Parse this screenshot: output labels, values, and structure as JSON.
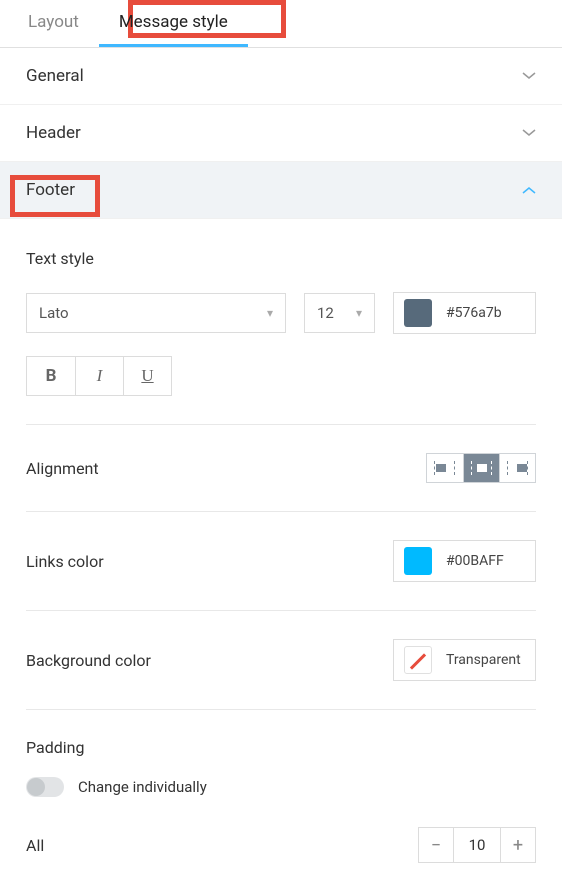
{
  "tabs": {
    "layout": "Layout",
    "message_style": "Message style"
  },
  "accordion": {
    "general": "General",
    "header": "Header",
    "footer": "Footer"
  },
  "footer_panel": {
    "text_style_title": "Text style",
    "font": "Lato",
    "font_size": "12",
    "text_color": "#576a7b",
    "bold": "B",
    "italic": "I",
    "underline": "U",
    "alignment_label": "Alignment",
    "links_color_label": "Links color",
    "links_color_value": "#00BAFF",
    "background_color_label": "Background color",
    "background_color_value": "Transparent",
    "padding_title": "Padding",
    "change_individually": "Change individually",
    "all_label": "All",
    "all_value": "10"
  }
}
